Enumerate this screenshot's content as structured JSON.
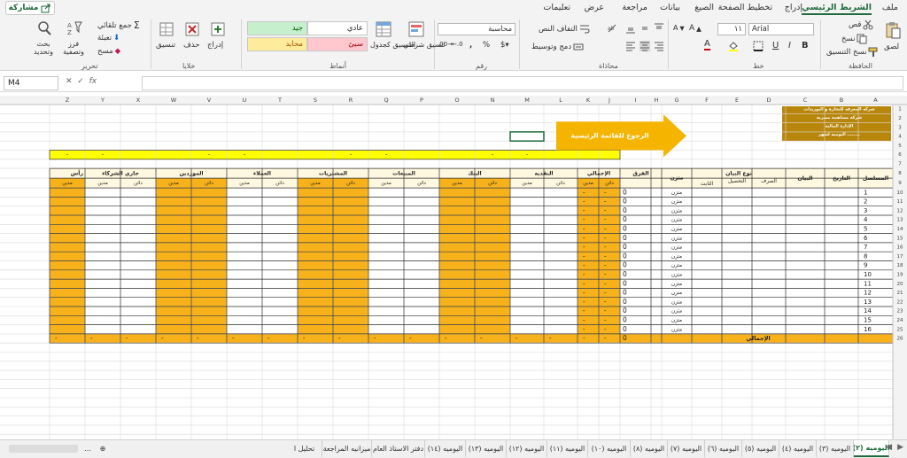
{
  "tabs": {
    "file": "ملف",
    "home": "الشريط الرئيسي",
    "insert": "إدراج",
    "layout": "تخطيط الصفحة",
    "formulas": "الصيغ",
    "data": "بيانات",
    "review": "مراجعة",
    "view": "عرض",
    "help": "تعليمات",
    "share": "مشاركة"
  },
  "ribbon": {
    "clipboard": {
      "paste": "لصق",
      "cut": "قص",
      "copy": "نسخ",
      "format_painter": "نسخ التنسيق",
      "label": "الحافظة"
    },
    "font": {
      "name": "Arial",
      "size": "١١",
      "label": "خط"
    },
    "alignment": {
      "wrap": "التفاف النص",
      "merge": "دمج وتوسيط",
      "label": "محاذاة"
    },
    "number": {
      "format": "محاسبة",
      "label": "رقم"
    },
    "styles": {
      "conditional": "تنسيق شرطي",
      "as_table": "التنسيق كجدول",
      "normal": "عادي",
      "good": "جيد",
      "bad": "سيئ",
      "neutral": "محايد",
      "label": "أنماط"
    },
    "cells": {
      "insert": "إدراج",
      "delete": "حذف",
      "format": "تنسيق",
      "label": "خلايا"
    },
    "editing": {
      "autosum": "جمع تلقائي",
      "fill": "تعبئة",
      "clear": "مسح",
      "sort": "فرز وتصفية",
      "find": "بحث وتحديد",
      "label": "تحرير"
    }
  },
  "formula_bar": {
    "name_box": "M4",
    "fx": "fx",
    "value": ""
  },
  "columns": [
    "A",
    "B",
    "C",
    "D",
    "E",
    "F",
    "G",
    "H",
    "I",
    "J",
    "K",
    "L",
    "M",
    "N",
    "O",
    "P",
    "Q",
    "R",
    "S",
    "T",
    "U",
    "V",
    "W",
    "X",
    "Y",
    "Z"
  ],
  "rows": [
    "1",
    "2",
    "3",
    "4",
    "5",
    "6",
    "7",
    "8",
    "9",
    "10",
    "11",
    "12",
    "13",
    "14",
    "15",
    "16",
    "17",
    "18",
    "19",
    "20",
    "21",
    "22",
    "23",
    "24",
    "25",
    "26"
  ],
  "sheet": {
    "company_lines": [
      "شركه المعرفه للتجاره و التوريدات",
      "شركة مساهمة مصرية",
      "الإداره الماليه",
      "اليوميه لشهر ........"
    ],
    "back_button": "الرجوع للقائمة الرئيسية",
    "headers": {
      "serial": "المسلسل",
      "date": "التاريخ",
      "statement": "البيان",
      "type": "نوع البيان",
      "expense": "الصرف",
      "collection": "التحصيل",
      "fixed": "الثابت",
      "balanced": "متزن",
      "diff": "الفرق",
      "total": "الإجمالي",
      "cash": "النقديه",
      "bank": "البنك",
      "sales": "المبيعات",
      "purchases": "المشتريات",
      "clients": "العملاء",
      "suppliers": "الموردين",
      "partners": "جاري الشركاء",
      "capital": "رأس",
      "debit": "مدين",
      "credit": "دائن"
    },
    "serials": [
      "1",
      "2",
      "3",
      "4",
      "5",
      "6",
      "7",
      "8",
      "9",
      "10",
      "11",
      "12",
      "13",
      "14",
      "15",
      "16"
    ],
    "row_status": "متزن",
    "diff_value": "0",
    "dash": "-",
    "grand_total_label": "الإجمالي",
    "grand_total_diff": "0"
  },
  "sheet_tabs": [
    "اليوميه (٢)",
    "اليوميه (٣)",
    "اليوميه (٤)",
    "اليوميه (٥)",
    "اليوميه (٦)",
    "اليوميه (٧)",
    "اليوميه (٨)",
    "اليوميه (١٠)",
    "اليوميه (١١)",
    "اليوميه (١٢)",
    "اليوميه (١٣)",
    "اليوميه (١٤)",
    "دفتر الاستاذ العام",
    "ميزانيه المراجعة",
    "تحليل ا"
  ],
  "colors": {
    "accent": "#1e6b3c",
    "orange": "#f7b21b",
    "yellow": "#ffff00",
    "gold": "#b8860b",
    "arrow": "#f5b400",
    "good": "#c6efce",
    "bad": "#ffc7ce",
    "neutral": "#ffeb9c"
  }
}
